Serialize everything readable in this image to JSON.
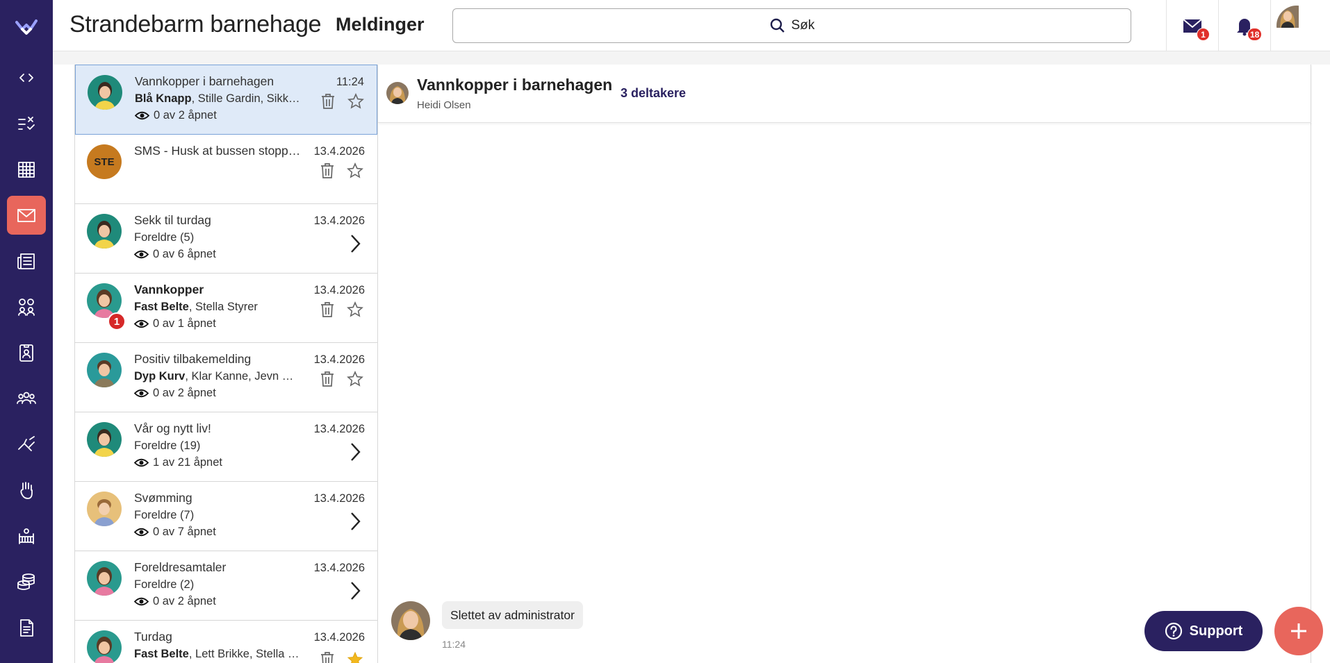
{
  "header": {
    "app_title": "Strandebarm barnehage",
    "page_title": "Meldinger",
    "search_label": "Søk",
    "messages_badge": "1",
    "notifications_badge": "18"
  },
  "colors": {
    "rail": "#2a2160",
    "accent": "#e8665c",
    "badge": "#e0302a",
    "selected_row": "#dfeaf8"
  },
  "rail": {
    "icons": [
      "logo-icon",
      "code-icon",
      "tasks-icon",
      "calendar-icon",
      "mail-icon",
      "news-icon",
      "groups-icon",
      "badge-icon",
      "people-icon",
      "activities-icon",
      "hand-icon",
      "crib-icon",
      "coins-icon",
      "document-icon"
    ],
    "active": "mail-icon"
  },
  "messages": [
    {
      "subject": "Vannkopper i barnehagen",
      "recipients_bold": "Blå Knapp",
      "recipients_rest": ", Stille Gardin, Sikker ...",
      "opened": "0 av 2 åpnet",
      "date": "11:24",
      "actions": "trash-star",
      "selected": true
    },
    {
      "subject": "SMS - Husk at bussen stoppe...",
      "initials": "STE",
      "recipients_bold": "",
      "recipients_rest": "",
      "opened": "",
      "date": "13.4.2026",
      "actions": "trash-star"
    },
    {
      "subject": "Sekk til turdag",
      "recipients_bold": "",
      "recipients_rest": "Foreldre (5)",
      "opened": "0 av 6 åpnet",
      "date": "13.4.2026",
      "actions": "chevron"
    },
    {
      "subject": "Vannkopper",
      "bold": true,
      "unread": "1",
      "recipients_bold": "Fast Belte",
      "recipients_rest": ", Stella Styrer",
      "opened": "0 av 1 åpnet",
      "date": "13.4.2026",
      "actions": "trash-star"
    },
    {
      "subject": "Positiv tilbakemelding",
      "recipients_bold": "Dyp Kurv",
      "recipients_rest": ", Klar Kanne, Jevn Ser...",
      "opened": "0 av 2 åpnet",
      "date": "13.4.2026",
      "actions": "trash-star"
    },
    {
      "subject": "Vår og nytt liv!",
      "recipients_bold": "",
      "recipients_rest": "Foreldre (19)",
      "opened": "1 av 21 åpnet",
      "date": "13.4.2026",
      "actions": "chevron"
    },
    {
      "subject": "Svømming",
      "recipients_bold": "",
      "recipients_rest": "Foreldre (7)",
      "opened": "0 av 7 åpnet",
      "date": "13.4.2026",
      "actions": "chevron"
    },
    {
      "subject": "Foreldresamtaler",
      "recipients_bold": "",
      "recipients_rest": "Foreldre (2)",
      "opened": "0 av 2 åpnet",
      "date": "13.4.2026",
      "actions": "chevron"
    },
    {
      "subject": "Turdag",
      "recipients_bold": "Fast Belte",
      "recipients_rest": ", Lett Brikke, Stella S...",
      "opened": "",
      "date": "13.4.2026",
      "actions": "trash-star-filled"
    }
  ],
  "conversation": {
    "title": "Vannkopper i barnehagen",
    "sender": "Heidi Olsen",
    "participants": "3 deltakere",
    "bubble_text": "Slettet av administrator",
    "bubble_time": "11:24"
  },
  "support_label": "Support"
}
